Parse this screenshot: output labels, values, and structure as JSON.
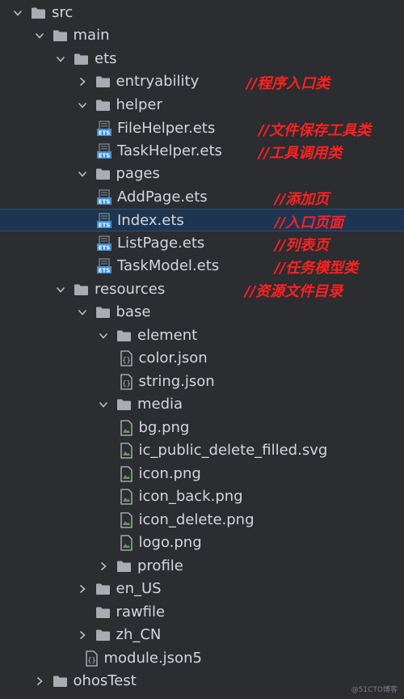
{
  "colors": {
    "background": "#2b2d30",
    "text": "#d3d6dc",
    "selection": "#1e3551",
    "annotation": "#ff2020",
    "folder": "#a9acb2",
    "ets_badge": "#3f8fd6",
    "json_icon": "#b8bbc1",
    "image_icon": "#5f9e5a"
  },
  "tree": {
    "src": "src",
    "main": "main",
    "ets": "ets",
    "entryability": "entryability",
    "helper": "helper",
    "filehelper": "FileHelper.ets",
    "taskhelper": "TaskHelper.ets",
    "pages": "pages",
    "addpage": "AddPage.ets",
    "index": "Index.ets",
    "listpage": "ListPage.ets",
    "taskmodel": "TaskModel.ets",
    "resources": "resources",
    "base": "base",
    "element": "element",
    "color_json": "color.json",
    "string_json": "string.json",
    "media": "media",
    "bg_png": "bg.png",
    "delete_svg": "ic_public_delete_filled.svg",
    "icon_png": "icon.png",
    "icon_back_png": "icon_back.png",
    "icon_delete_png": "icon_delete.png",
    "logo_png": "logo.png",
    "profile": "profile",
    "en_us": "en_US",
    "rawfile": "rawfile",
    "zh_cn": "zh_CN",
    "module_json5": "module.json5",
    "ohostest": "ohosTest"
  },
  "annotations": {
    "entryability": "//程序入口类",
    "filehelper": "//文件保存工具类",
    "taskhelper": "//工具调用类",
    "addpage": "//添加页",
    "index": "//入口页面",
    "listpage": "//列表页",
    "taskmodel": "//任务模型类",
    "resources": "//资源文件目录"
  },
  "badge_text": "ETS",
  "watermark": "@51CTO博客"
}
